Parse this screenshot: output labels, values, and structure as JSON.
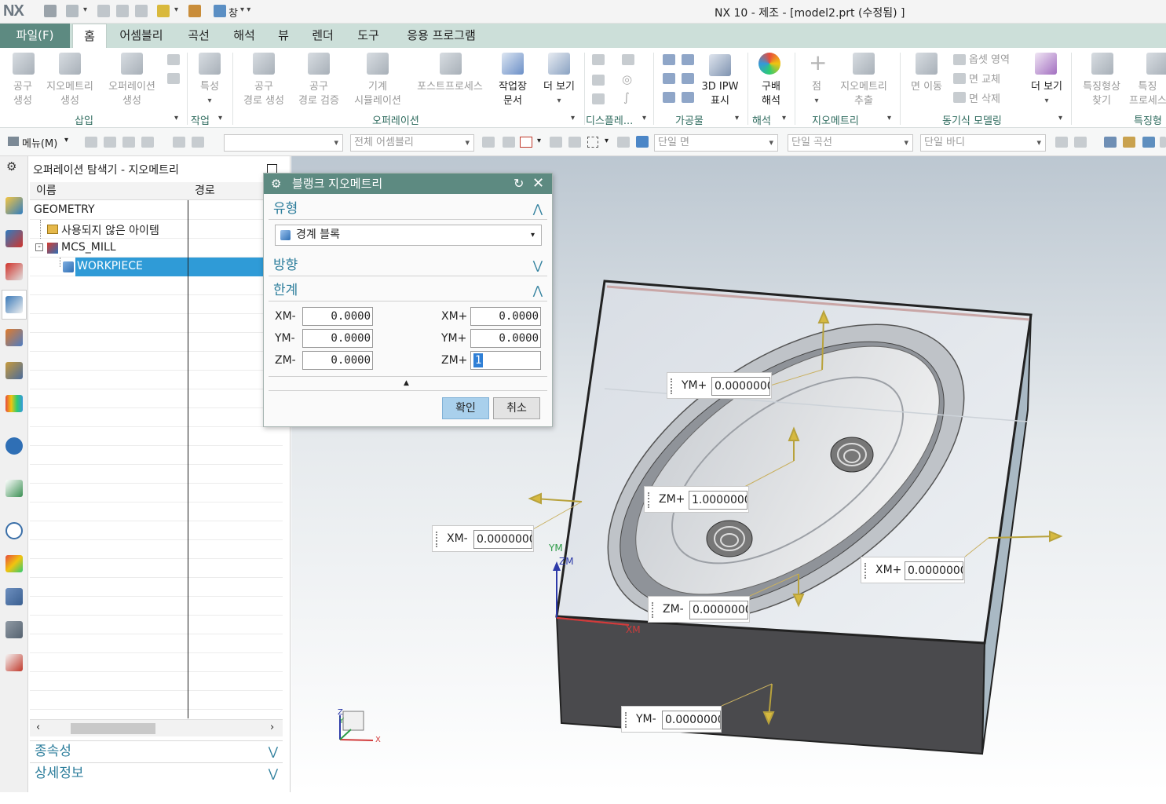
{
  "titlebar": {
    "logo": "NX",
    "window_label": "창",
    "title": "NX 10 - 제조 - [model2.prt (수정됨) ]"
  },
  "tabs": {
    "file": "파일(F)",
    "items": [
      "홈",
      "어셈블리",
      "곡선",
      "해석",
      "뷰",
      "렌더",
      "도구",
      "응용 프로그램"
    ]
  },
  "ribbon": {
    "insert": {
      "workpiece_create": [
        "공구",
        "생성"
      ],
      "geometry_create": [
        "지오메트리",
        "생성"
      ],
      "operation_create": [
        "오퍼레이션",
        "생성"
      ],
      "group": "삽입"
    },
    "work": {
      "feature": "특성",
      "group": "작업"
    },
    "operation": {
      "toolpath_create": [
        "공구",
        "경로 생성"
      ],
      "toolpath_verify": [
        "공구",
        "경로 검증"
      ],
      "machine_sim": [
        "기계",
        "시뮬레이션"
      ],
      "postprocess": "포스트프로세스",
      "shop_doc": [
        "작업장",
        "문서"
      ],
      "more": "더 보기",
      "group": "오퍼레이션"
    },
    "display": {
      "group": "디스플레..."
    },
    "workpiece": {
      "ipw": [
        "3D IPW",
        "표시"
      ],
      "group": "가공물"
    },
    "analysis": {
      "draft": [
        "구배",
        "해석"
      ],
      "group": "해석"
    },
    "geometry": {
      "point": "점",
      "extract": [
        "지오메트리",
        "추출"
      ],
      "group": "지오메트리"
    },
    "sync": {
      "move_face": "면 이동",
      "offset_region": "옵셋 영역",
      "replace_face": "면 교체",
      "delete_face": "면 삭제",
      "more": "더 보기",
      "group": "동기식 모델링"
    },
    "feature": {
      "find": [
        "특징형상",
        "찾기"
      ],
      "process": [
        "특징",
        "프로세스"
      ],
      "group": "특징형"
    }
  },
  "cmdbar": {
    "menu": "메뉴(M)",
    "filter1": "",
    "filter2": "전체 어셈블리",
    "filter3": "단일 면",
    "filter4": "단일 곡선",
    "filter5": "단일 바디"
  },
  "navigator": {
    "title": "오퍼레이션 탐색기 - 지오메트리",
    "col_name": "이름",
    "col_path": "경로",
    "rows": [
      "GEOMETRY",
      "사용되지 않은 아이템",
      "MCS_MILL",
      "WORKPIECE"
    ],
    "panels": [
      "종속성",
      "상세정보"
    ]
  },
  "dialog": {
    "title": "블랭크 지오메트리",
    "type_section": "유형",
    "type_value": "경계 블록",
    "direction_section": "방향",
    "limits_section": "한계",
    "xm_minus_label": "XM-",
    "ym_minus_label": "YM-",
    "zm_minus_label": "ZM-",
    "xm_plus_label": "XM+",
    "ym_plus_label": "YM+",
    "zm_plus_label": "ZM+",
    "xm_minus": "0.0000",
    "ym_minus": "0.0000",
    "zm_minus": "0.0000",
    "xm_plus": "0.0000",
    "ym_plus": "0.0000",
    "zm_plus": "1",
    "ok": "확인",
    "cancel": "취소"
  },
  "viewport": {
    "handles": {
      "ym_plus": {
        "label": "YM+",
        "value": "0.0000000"
      },
      "zm_plus": {
        "label": "ZM+",
        "value": "1.0000000"
      },
      "xm_minus": {
        "label": "XM-",
        "value": "0.0000000"
      },
      "xm_plus": {
        "label": "XM+",
        "value": "0.0000000"
      },
      "zm_minus": {
        "label": "ZM-",
        "value": "0.0000000"
      },
      "ym_minus": {
        "label": "YM-",
        "value": "0.0000000"
      }
    },
    "mcs_labels": {
      "ym": "YM",
      "zm": "ZM",
      "xm": "XM"
    },
    "triad": {
      "x": "X",
      "y": "Y",
      "z": "Z"
    }
  },
  "colors": {
    "accent": "#5d8a81",
    "tab_bar": "#ccdfd9",
    "selection": "#2f9bd7",
    "section_text": "#2d7e9c"
  }
}
